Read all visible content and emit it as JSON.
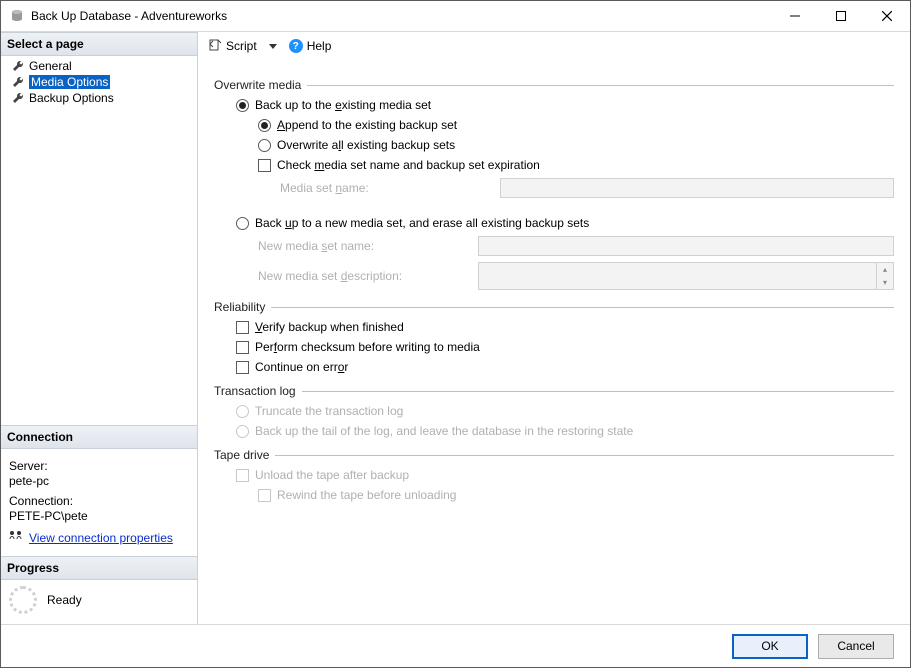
{
  "window": {
    "title": "Back Up Database - Adventureworks"
  },
  "sidebar": {
    "select_page": "Select a page",
    "items": [
      {
        "label": "General",
        "selected": false
      },
      {
        "label": "Media Options",
        "selected": true
      },
      {
        "label": "Backup Options",
        "selected": false
      }
    ],
    "connection_header": "Connection",
    "server_label": "Server:",
    "server_value": "pete-pc",
    "connection_label": "Connection:",
    "connection_value": "PETE-PC\\pete",
    "view_connection_link": "View connection properties",
    "progress_header": "Progress",
    "progress_status": "Ready"
  },
  "toolbar": {
    "script": "Script",
    "help": "Help"
  },
  "groups": {
    "overwrite": {
      "title": "Overwrite media",
      "opt_existing": "Back up to the existing media set",
      "opt_existing_prefix": "Back up to the ",
      "opt_existing_accel": "e",
      "opt_existing_suffix": "xisting media set",
      "append_prefix": "",
      "append_accel": "A",
      "append_suffix": "ppend to the existing backup set",
      "overwrite_all_prefix": "Overwrite a",
      "overwrite_all_accel": "l",
      "overwrite_all_suffix": "l existing backup sets",
      "check_media_prefix": "Check ",
      "check_media_accel": "m",
      "check_media_suffix": "edia set name and backup set expiration",
      "media_set_name_label_prefix": "Media set ",
      "media_set_name_label_accel": "n",
      "media_set_name_label_suffix": "ame:",
      "opt_new_prefix": "Back ",
      "opt_new_accel": "u",
      "opt_new_suffix": "p to a new media set, and erase all existing backup sets",
      "new_name_label_prefix": "New media ",
      "new_name_label_accel": "s",
      "new_name_label_suffix": "et name:",
      "new_desc_label_prefix": "New media set ",
      "new_desc_label_accel": "d",
      "new_desc_label_suffix": "escription:"
    },
    "reliability": {
      "title": "Reliability",
      "verify_accel": "V",
      "verify_suffix": "erify backup when finished",
      "checksum_prefix": "Per",
      "checksum_accel": "f",
      "checksum_suffix": "orm checksum before writing to media",
      "continue_prefix": "Continue on err",
      "continue_accel": "o",
      "continue_suffix": "r"
    },
    "tlog": {
      "title": "Transaction log",
      "truncate": "Truncate the transaction log",
      "tail": "Back up the tail of the log, and leave the database in the restoring state"
    },
    "tape": {
      "title": "Tape drive",
      "unload": "Unload the tape after backup",
      "rewind": "Rewind the tape before unloading"
    }
  },
  "footer": {
    "ok": "OK",
    "cancel": "Cancel"
  }
}
